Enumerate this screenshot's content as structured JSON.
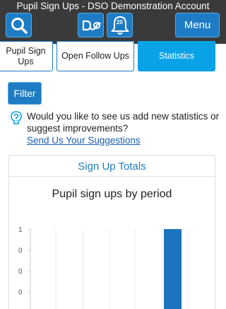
{
  "header": {
    "title": "Pupil Sign Ups - DSO Demonstration Account",
    "notification_count": "20",
    "menu_label": "Menu"
  },
  "tabs": [
    {
      "label": "Pupil Sign Ups"
    },
    {
      "label": "Open Follow Ups"
    },
    {
      "label": "Statistics"
    }
  ],
  "filter_label": "Filter",
  "suggestion": {
    "text": "Would you like to see us add new statistics or suggest improvements?",
    "link": "Send Us Your Suggestions"
  },
  "panel": {
    "heading": "Sign Up Totals"
  },
  "chart_data": {
    "type": "bar",
    "title": "Pupil sign ups by period",
    "y_tick_labels": [
      "1",
      "0",
      "0",
      "0"
    ],
    "bar_color": "#1e73be",
    "series": [
      {
        "values": [
          1
        ]
      }
    ]
  },
  "colors": {
    "topbar": "#3a3a3a",
    "button": "#1e7cc4",
    "active_tab": "#0aa2e6",
    "link": "#1a5fb4"
  }
}
